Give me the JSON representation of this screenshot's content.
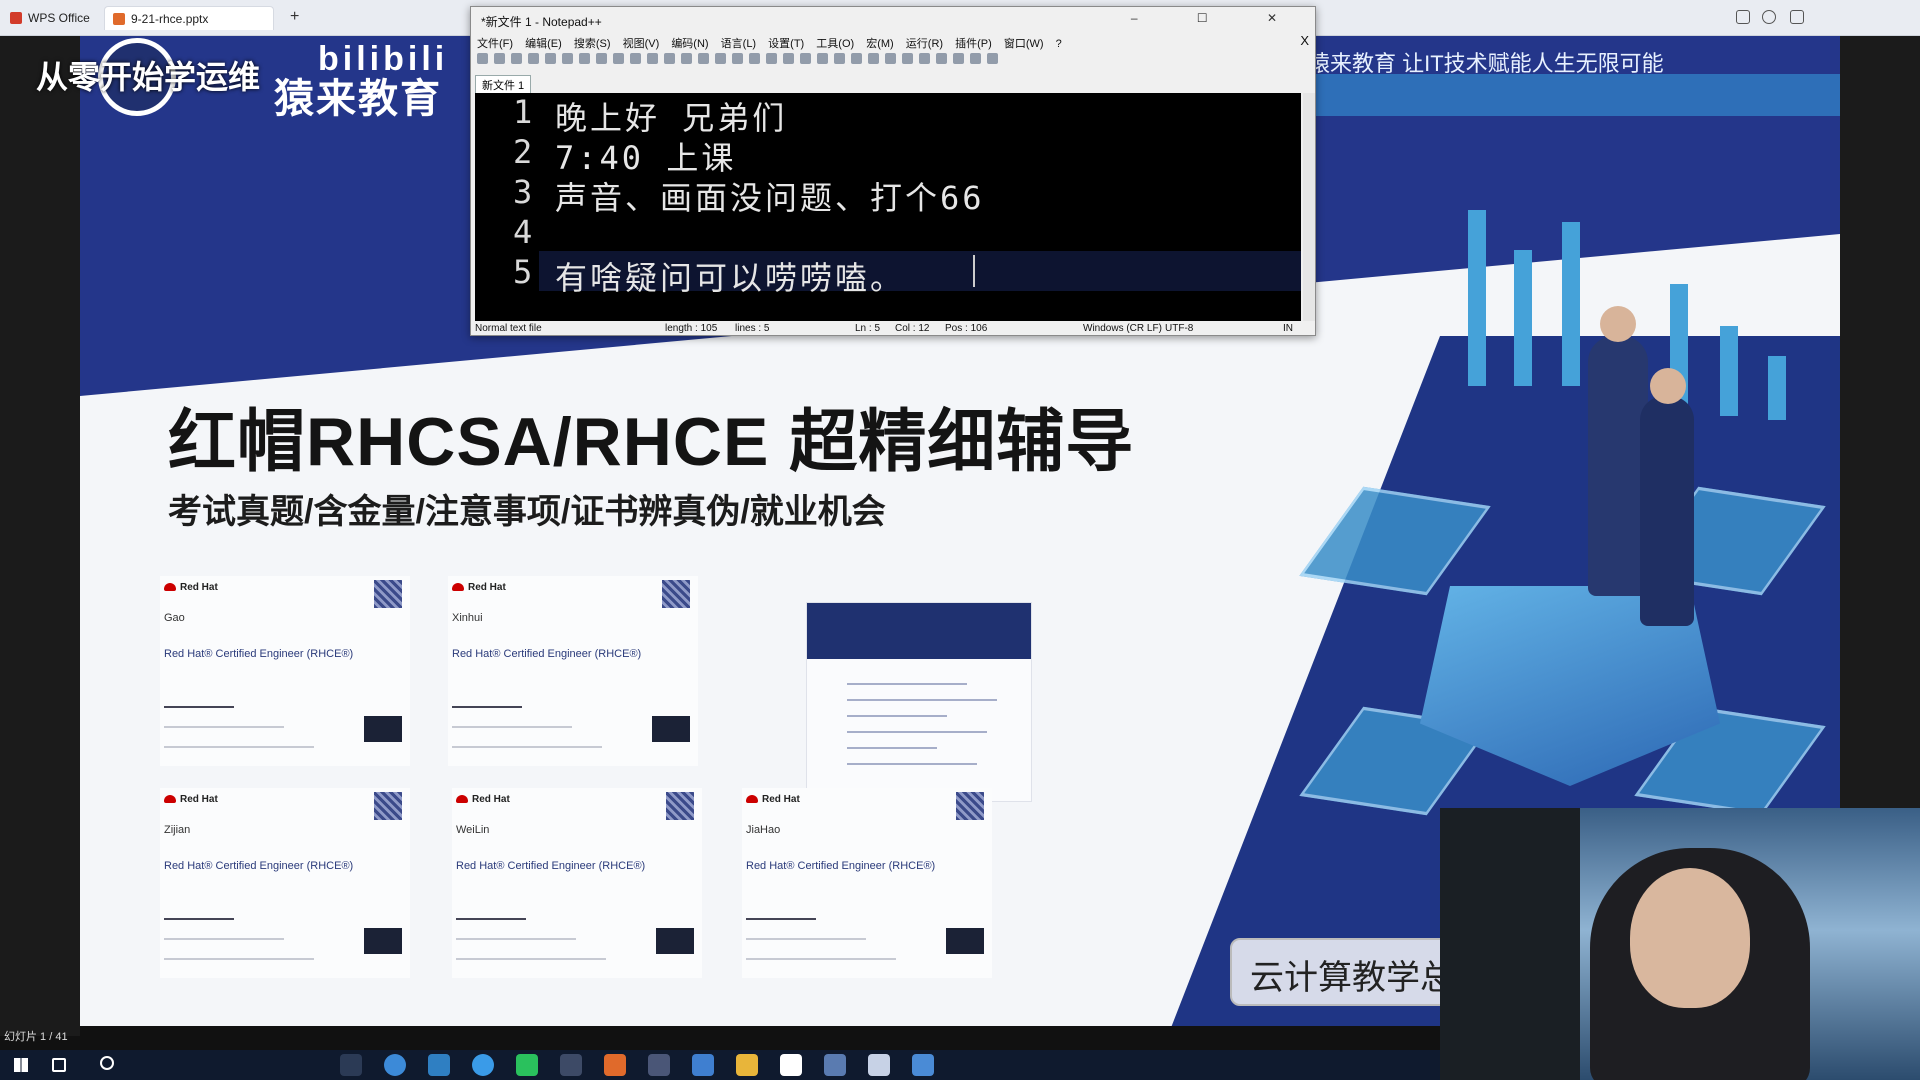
{
  "wps": {
    "app_tab": "WPS Office",
    "file_tab": "9-21-rhce.pptx",
    "new_tab": "+"
  },
  "overlay": {
    "title": "从零开始学运维",
    "bili": "bilibili",
    "brand": "猿来教育",
    "slogan": "猿来教育 让IT技术赋能人生无限可能"
  },
  "slide": {
    "main_title": "红帽RHCSA/RHCE 超精细辅导",
    "sub_title": "考试真题/含金量/注意事项/证书辨真伪/就业机会",
    "counter": "幻灯片 1 / 41",
    "cloud_label": "云计算教学总"
  },
  "certificates": [
    {
      "brand": "Red Hat",
      "name": "Gao",
      "title": "Red Hat® Certified Engineer (RHCE®)"
    },
    {
      "brand": "Red Hat",
      "name": "Xinhui",
      "title": "Red Hat® Certified Engineer (RHCE®)"
    },
    {
      "brand": "Red Hat",
      "name": "Zijian",
      "title": "Red Hat® Certified Engineer (RHCE®)"
    },
    {
      "brand": "Red Hat",
      "name": "WeiLin",
      "title": "Red Hat® Certified Engineer (RHCE®)"
    },
    {
      "brand": "Red Hat",
      "name": "JiaHao",
      "title": "Red Hat® Certified Engineer (RHCE®)"
    }
  ],
  "notepad": {
    "title": "*新文件 1 - Notepad++",
    "controls": "–  ☐  ✕",
    "close_doc": "X",
    "menu": [
      "文件(F)",
      "编辑(E)",
      "搜索(S)",
      "视图(V)",
      "编码(N)",
      "语言(L)",
      "设置(T)",
      "工具(O)",
      "宏(M)",
      "运行(R)",
      "插件(P)",
      "窗口(W)",
      "?"
    ],
    "tab": "新文件 1",
    "lines": [
      {
        "num": "1",
        "text": "晚上好 兄弟们"
      },
      {
        "num": "2",
        "text": "7:40 上课"
      },
      {
        "num": "3",
        "text": "声音、画面没问题、打个66"
      },
      {
        "num": "4",
        "text": ""
      },
      {
        "num": "5",
        "text": "有啥疑问可以唠唠嗑。"
      }
    ],
    "status": {
      "type": "Normal text file",
      "length": "length : 105",
      "lines": "lines : 5",
      "ln": "Ln : 5",
      "col": "Col : 12",
      "pos": "Pos : 106",
      "eol": "Windows (CR LF)",
      "encoding": "UTF-8",
      "mode": "IN"
    }
  },
  "colors": {
    "slide_blue": "#24368a",
    "banner": "#2e6fb8",
    "editor_bg": "#000000",
    "taskbar": "#0f1a2e"
  }
}
